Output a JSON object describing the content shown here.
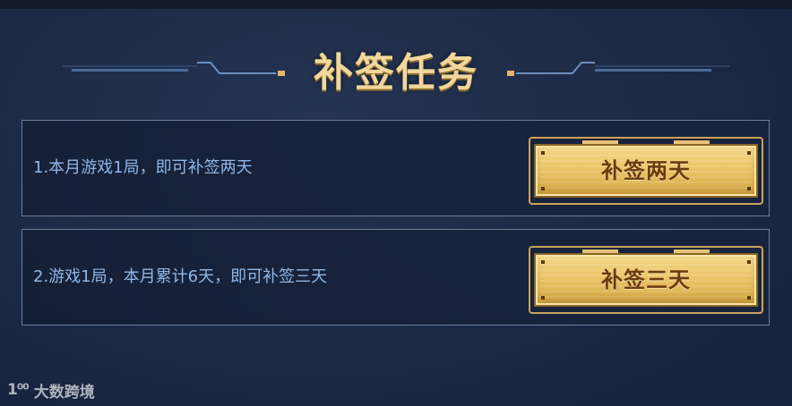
{
  "header": {
    "title": "补签任务"
  },
  "tasks": [
    {
      "text": "1.本月游戏1局，即可补签两天",
      "button_label": "补签两天"
    },
    {
      "text": "2.游戏1局，本月累计6天，即可补签三天",
      "button_label": "补签三天"
    }
  ],
  "watermark": {
    "logo": "1⁰⁰",
    "text": "大数跨境"
  },
  "colors": {
    "title": "#f1d79b",
    "task_text": "#8fb6e6",
    "button_gold": "#ebc568",
    "button_text": "#6a3c10",
    "border": "#6f7e9a"
  },
  "icons": {
    "title_deco_left": "line-ornament-left",
    "title_deco_right": "line-ornament-right",
    "watermark_logo": "watermark-logo-icon"
  }
}
